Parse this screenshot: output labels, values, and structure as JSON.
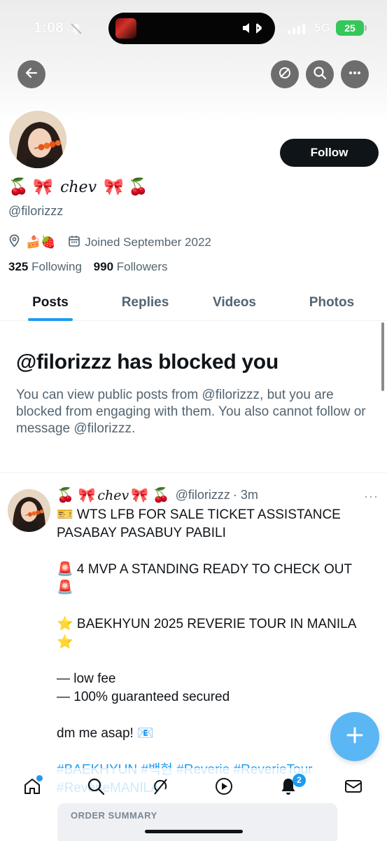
{
  "status_bar": {
    "time": "1:08",
    "network": "5G",
    "battery": "25"
  },
  "profile": {
    "display_name_prefix": "🍒 🎀",
    "display_name_script": "chev",
    "display_name_suffix": "🎀 🍒",
    "handle": "@filorizzz",
    "location_emoji": "🍰🍓",
    "joined": "Joined September 2022",
    "following_count": "325",
    "following_label": "Following",
    "followers_count": "990",
    "followers_label": "Followers",
    "follow_button": "Follow"
  },
  "tabs": [
    {
      "label": "Posts",
      "active": true
    },
    {
      "label": "Replies",
      "active": false
    },
    {
      "label": "Videos",
      "active": false
    },
    {
      "label": "Photos",
      "active": false
    }
  ],
  "blocked": {
    "title": "@filorizzz has blocked you",
    "description": "You can view public posts from @filorizzz, but you are blocked from engaging with them. You also cannot follow or message @filorizzz."
  },
  "tweet": {
    "name_prefix": "🍒 🎀",
    "name_script": "chev",
    "name_suffix": "🎀 🍒",
    "handle": "@filorizzz",
    "time": "· 3m",
    "more": "···",
    "lines": [
      "🎫 WTS LFB FOR SALE TICKET ASSISTANCE PASABAY PASABUY PABILI",
      "",
      "🚨 4 MVP A STANDING READY TO CHECK OUT 🚨",
      "",
      "⭐ BAEKHYUN 2025 REVERIE TOUR IN MANILA ⭐",
      "",
      "— low fee",
      "— 100% guaranteed secured",
      "",
      "dm me asap! 📧",
      ""
    ],
    "hashtags": "#BAEKHYUN #백현 #Reverie #ReverieTour #ReverieMANILA",
    "attachment_title": "ORDER SUMMARY"
  },
  "bottom_nav": {
    "notifications_badge": "2"
  },
  "colors": {
    "accent": "#1d9bf0",
    "text_primary": "#0f1419",
    "text_secondary": "#536471"
  },
  "icons": {
    "back": "arrow-left-icon",
    "translate": "no-translate-icon",
    "search": "search-icon",
    "more": "more-horizontal-icon",
    "location": "location-pin-icon",
    "calendar": "calendar-icon",
    "fab": "plus-icon",
    "nav": [
      "home-icon",
      "search-icon",
      "grok-icon",
      "video-icon",
      "bell-icon",
      "mail-icon"
    ]
  }
}
